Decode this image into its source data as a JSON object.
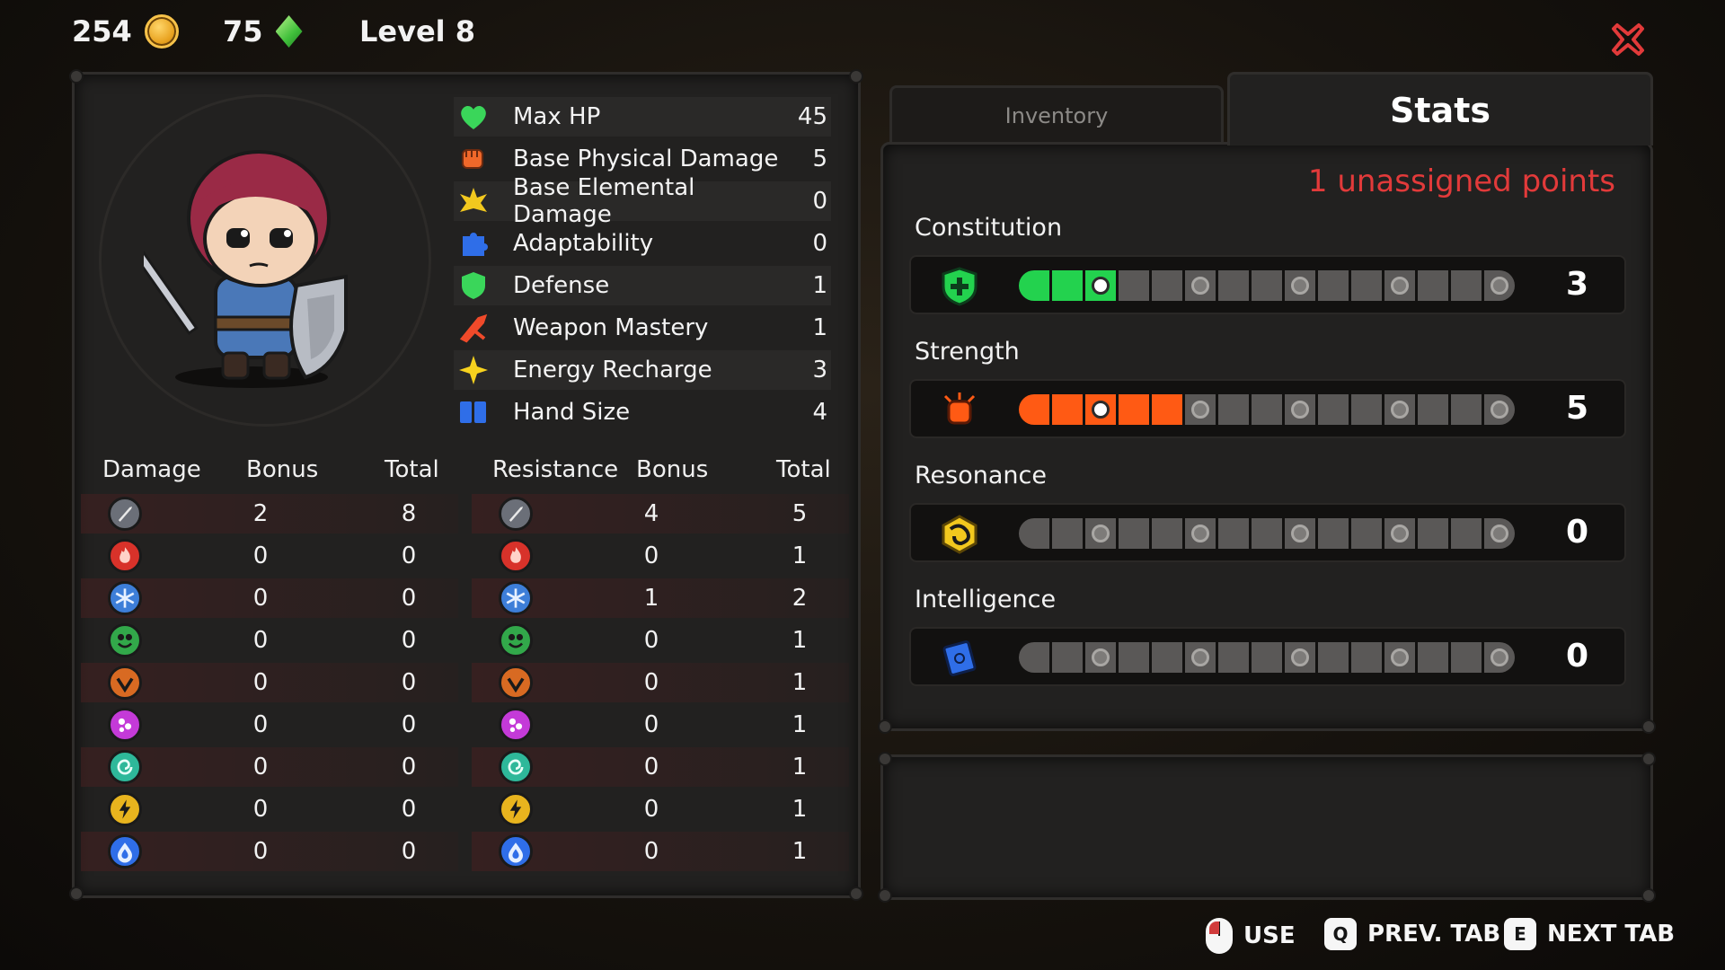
{
  "topbar": {
    "coins": "254",
    "gems": "75",
    "level": "Level 8"
  },
  "character_stats": [
    {
      "label": "Max HP",
      "value": "45",
      "icon": "heart-icon",
      "color": "#3ad65a"
    },
    {
      "label": "Base Physical Damage",
      "value": "5",
      "icon": "fist-icon",
      "color": "#f0682a"
    },
    {
      "label": "Base Elemental Damage",
      "value": "0",
      "icon": "burst-icon",
      "color": "#f2c81e"
    },
    {
      "label": "Adaptability",
      "value": "0",
      "icon": "puzzle-icon",
      "color": "#2f6ee8"
    },
    {
      "label": "Defense",
      "value": "1",
      "icon": "shield-icon",
      "color": "#3ad65a"
    },
    {
      "label": "Weapon Mastery",
      "value": "1",
      "icon": "weapon-icon",
      "color": "#f04a2a"
    },
    {
      "label": "Energy Recharge",
      "value": "3",
      "icon": "star-icon",
      "color": "#f7d21e"
    },
    {
      "label": "Hand Size",
      "value": "4",
      "icon": "cards-icon",
      "color": "#2f6ee8"
    }
  ],
  "damage_table": {
    "headers": {
      "damage": "Damage",
      "bonus": "Bonus",
      "total": "Total"
    },
    "rows": [
      {
        "icon": "sword-icon",
        "color": "#6b6f78",
        "bonus": "2",
        "total": "8"
      },
      {
        "icon": "fire-icon",
        "color": "#d8322a",
        "bonus": "0",
        "total": "0"
      },
      {
        "icon": "ice-icon",
        "color": "#3d7ed8",
        "bonus": "0",
        "total": "0"
      },
      {
        "icon": "poison-icon",
        "color": "#32a84a",
        "bonus": "0",
        "total": "0"
      },
      {
        "icon": "earth-icon",
        "color": "#d86a22",
        "bonus": "0",
        "total": "0"
      },
      {
        "icon": "arcane-icon",
        "color": "#c43ad8",
        "bonus": "0",
        "total": "0"
      },
      {
        "icon": "wind-icon",
        "color": "#2eb89a",
        "bonus": "0",
        "total": "0"
      },
      {
        "icon": "lightning-icon",
        "color": "#e8b41e",
        "bonus": "0",
        "total": "0"
      },
      {
        "icon": "water-icon",
        "color": "#2f6ee8",
        "bonus": "0",
        "total": "0"
      }
    ]
  },
  "resistance_table": {
    "headers": {
      "resistance": "Resistance",
      "bonus": "Bonus",
      "total": "Total"
    },
    "rows": [
      {
        "icon": "sword-icon",
        "color": "#6b6f78",
        "bonus": "4",
        "total": "5"
      },
      {
        "icon": "fire-icon",
        "color": "#d8322a",
        "bonus": "0",
        "total": "1"
      },
      {
        "icon": "ice-icon",
        "color": "#3d7ed8",
        "bonus": "1",
        "total": "2"
      },
      {
        "icon": "poison-icon",
        "color": "#32a84a",
        "bonus": "0",
        "total": "1"
      },
      {
        "icon": "earth-icon",
        "color": "#d86a22",
        "bonus": "0",
        "total": "1"
      },
      {
        "icon": "arcane-icon",
        "color": "#c43ad8",
        "bonus": "0",
        "total": "1"
      },
      {
        "icon": "wind-icon",
        "color": "#2eb89a",
        "bonus": "0",
        "total": "1"
      },
      {
        "icon": "lightning-icon",
        "color": "#e8b41e",
        "bonus": "0",
        "total": "1"
      },
      {
        "icon": "water-icon",
        "color": "#2f6ee8",
        "bonus": "0",
        "total": "1"
      }
    ]
  },
  "tabs": {
    "inventory": "Inventory",
    "stats": "Stats"
  },
  "unassigned_points": "1 unassigned points",
  "attributes": [
    {
      "name": "Constitution",
      "value": "3",
      "filled": 3,
      "max_pips": 15,
      "color": "#23d24e",
      "icon": "constitution-shield-icon"
    },
    {
      "name": "Strength",
      "value": "5",
      "filled": 5,
      "max_pips": 15,
      "color": "#ff5a14",
      "icon": "strength-fist-icon"
    },
    {
      "name": "Resonance",
      "value": "0",
      "filled": 0,
      "max_pips": 15,
      "color": "#f2c81e",
      "icon": "resonance-rune-icon"
    },
    {
      "name": "Intelligence",
      "value": "0",
      "filled": 0,
      "max_pips": 15,
      "color": "#2f6ee8",
      "icon": "intelligence-book-icon"
    }
  ],
  "controls": {
    "use_label": "USE",
    "prev_key": "Q",
    "prev_label": "PREV. TAB",
    "next_key": "E",
    "next_label": "NEXT TAB"
  },
  "colors": {
    "accent_red": "#e23a3a",
    "panel": "#222120"
  }
}
